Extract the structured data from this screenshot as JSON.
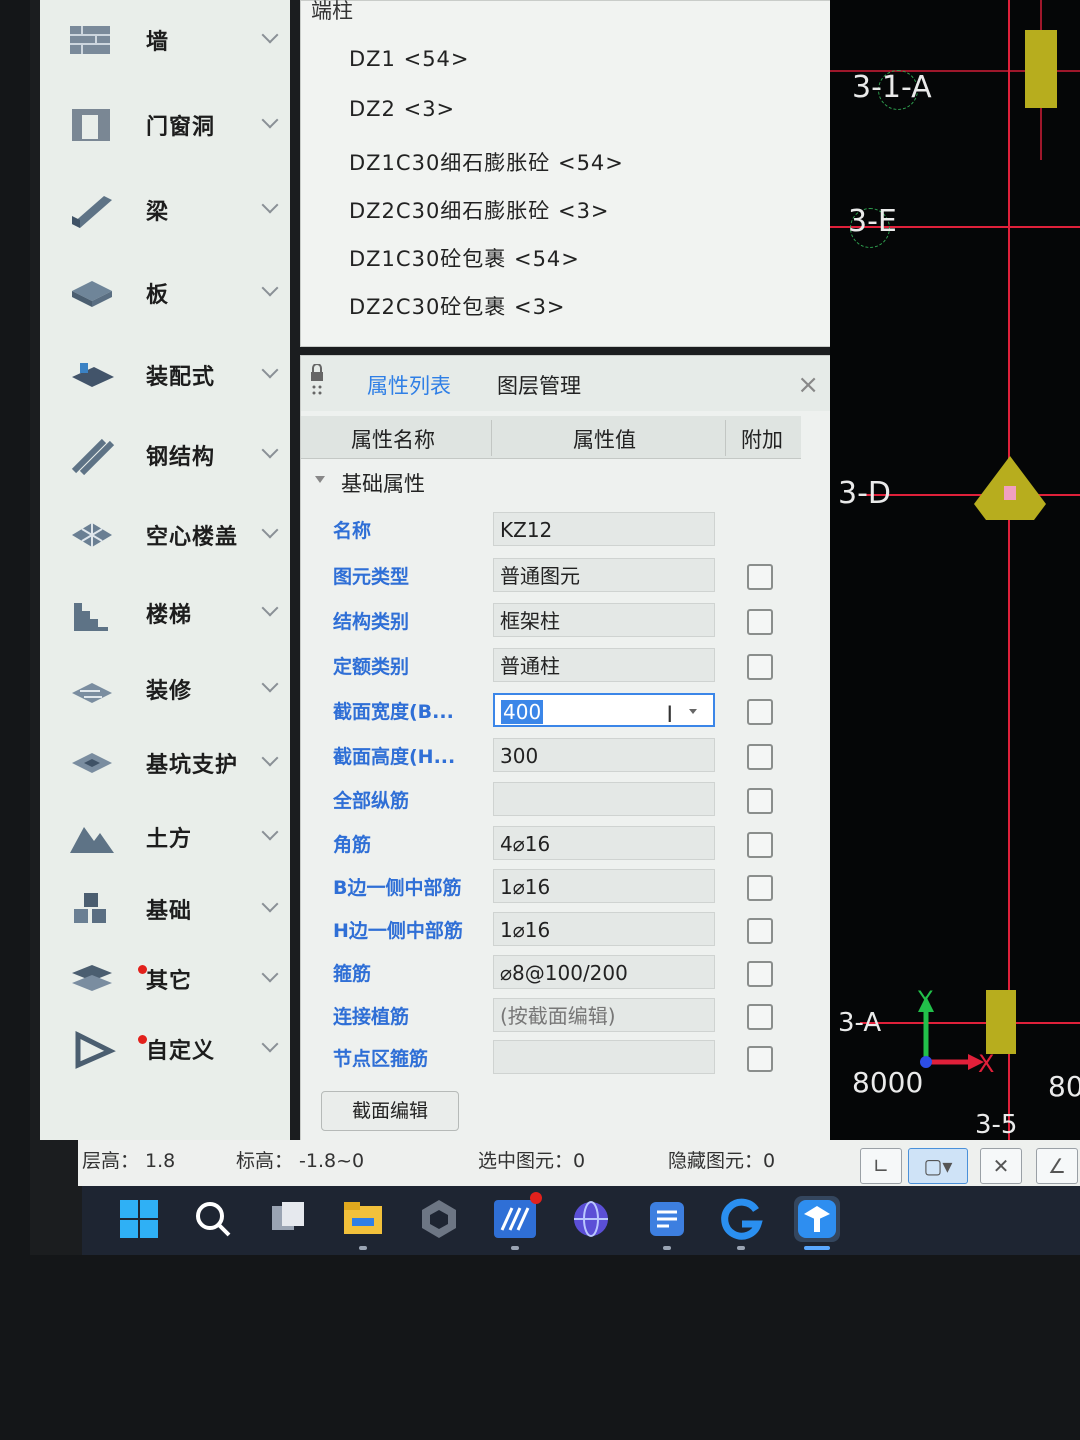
{
  "sidebar": {
    "items": [
      {
        "label": "墙",
        "icon": "wall-icon"
      },
      {
        "label": "门窗洞",
        "icon": "door-window-icon"
      },
      {
        "label": "梁",
        "icon": "beam-icon"
      },
      {
        "label": "板",
        "icon": "slab-icon"
      },
      {
        "label": "装配式",
        "icon": "prefab-icon"
      },
      {
        "label": "钢结构",
        "icon": "steel-structure-icon"
      },
      {
        "label": "空心楼盖",
        "icon": "hollow-floor-icon"
      },
      {
        "label": "楼梯",
        "icon": "stairs-icon"
      },
      {
        "label": "装修",
        "icon": "decoration-icon"
      },
      {
        "label": "基坑支护",
        "icon": "pit-support-icon"
      },
      {
        "label": "土方",
        "icon": "earthwork-icon"
      },
      {
        "label": "基础",
        "icon": "foundation-icon"
      },
      {
        "label": "其它",
        "icon": "other-icon"
      },
      {
        "label": "自定义",
        "icon": "custom-icon"
      }
    ]
  },
  "tree": {
    "header": "端柱",
    "items": [
      "DZ1 <54>",
      "DZ2 <3>",
      "DZ1C30细石膨胀砼 <54>",
      "DZ2C30细石膨胀砼 <3>",
      "DZ1C30砼包裹 <54>",
      "DZ2C30砼包裹 <3>"
    ]
  },
  "props": {
    "tab_active": "属性列表",
    "tab_inactive": "图层管理",
    "col_name": "属性名称",
    "col_value": "属性值",
    "col_extra": "附加",
    "group": "基础属性",
    "rows": [
      {
        "name": "名称",
        "value": "KZ12"
      },
      {
        "name": "图元类型",
        "value": "普通图元"
      },
      {
        "name": "结构类别",
        "value": "框架柱"
      },
      {
        "name": "定额类别",
        "value": "普通柱"
      },
      {
        "name": "截面宽度(B...",
        "value": "400"
      },
      {
        "name": "截面高度(H...",
        "value": "300"
      },
      {
        "name": "全部纵筋",
        "value": ""
      },
      {
        "name": "角筋",
        "value": "4⌀16"
      },
      {
        "name": "B边一侧中部筋",
        "value": "1⌀16"
      },
      {
        "name": "H边一侧中部筋",
        "value": "1⌀16"
      },
      {
        "name": "箍筋",
        "value": "⌀8@100/200"
      },
      {
        "name": "连接植筋",
        "value": "(按截面编辑)"
      },
      {
        "name": "节点区箍筋",
        "value": ""
      }
    ],
    "edit_button": "截面编辑"
  },
  "canvas": {
    "labels": [
      "3-1-A",
      "3-E",
      "3-D",
      "3-A",
      "3-5"
    ],
    "dimensions": [
      "8000",
      "80"
    ],
    "axis_x": "X",
    "axis_y": "Y"
  },
  "status": {
    "floor_height": "层高：  1.8",
    "elevation": "标高：  -1.8~0",
    "selected": "选中图元：0",
    "hidden": "隐藏图元：0"
  },
  "taskbar": {
    "apps": [
      "windows-start-icon",
      "search-icon",
      "task-view-icon",
      "file-explorer-icon",
      "app-cube-icon",
      "app-blue-icon",
      "globe-icon",
      "app-notes-icon",
      "app-g-icon",
      "glodon-app-icon"
    ]
  }
}
